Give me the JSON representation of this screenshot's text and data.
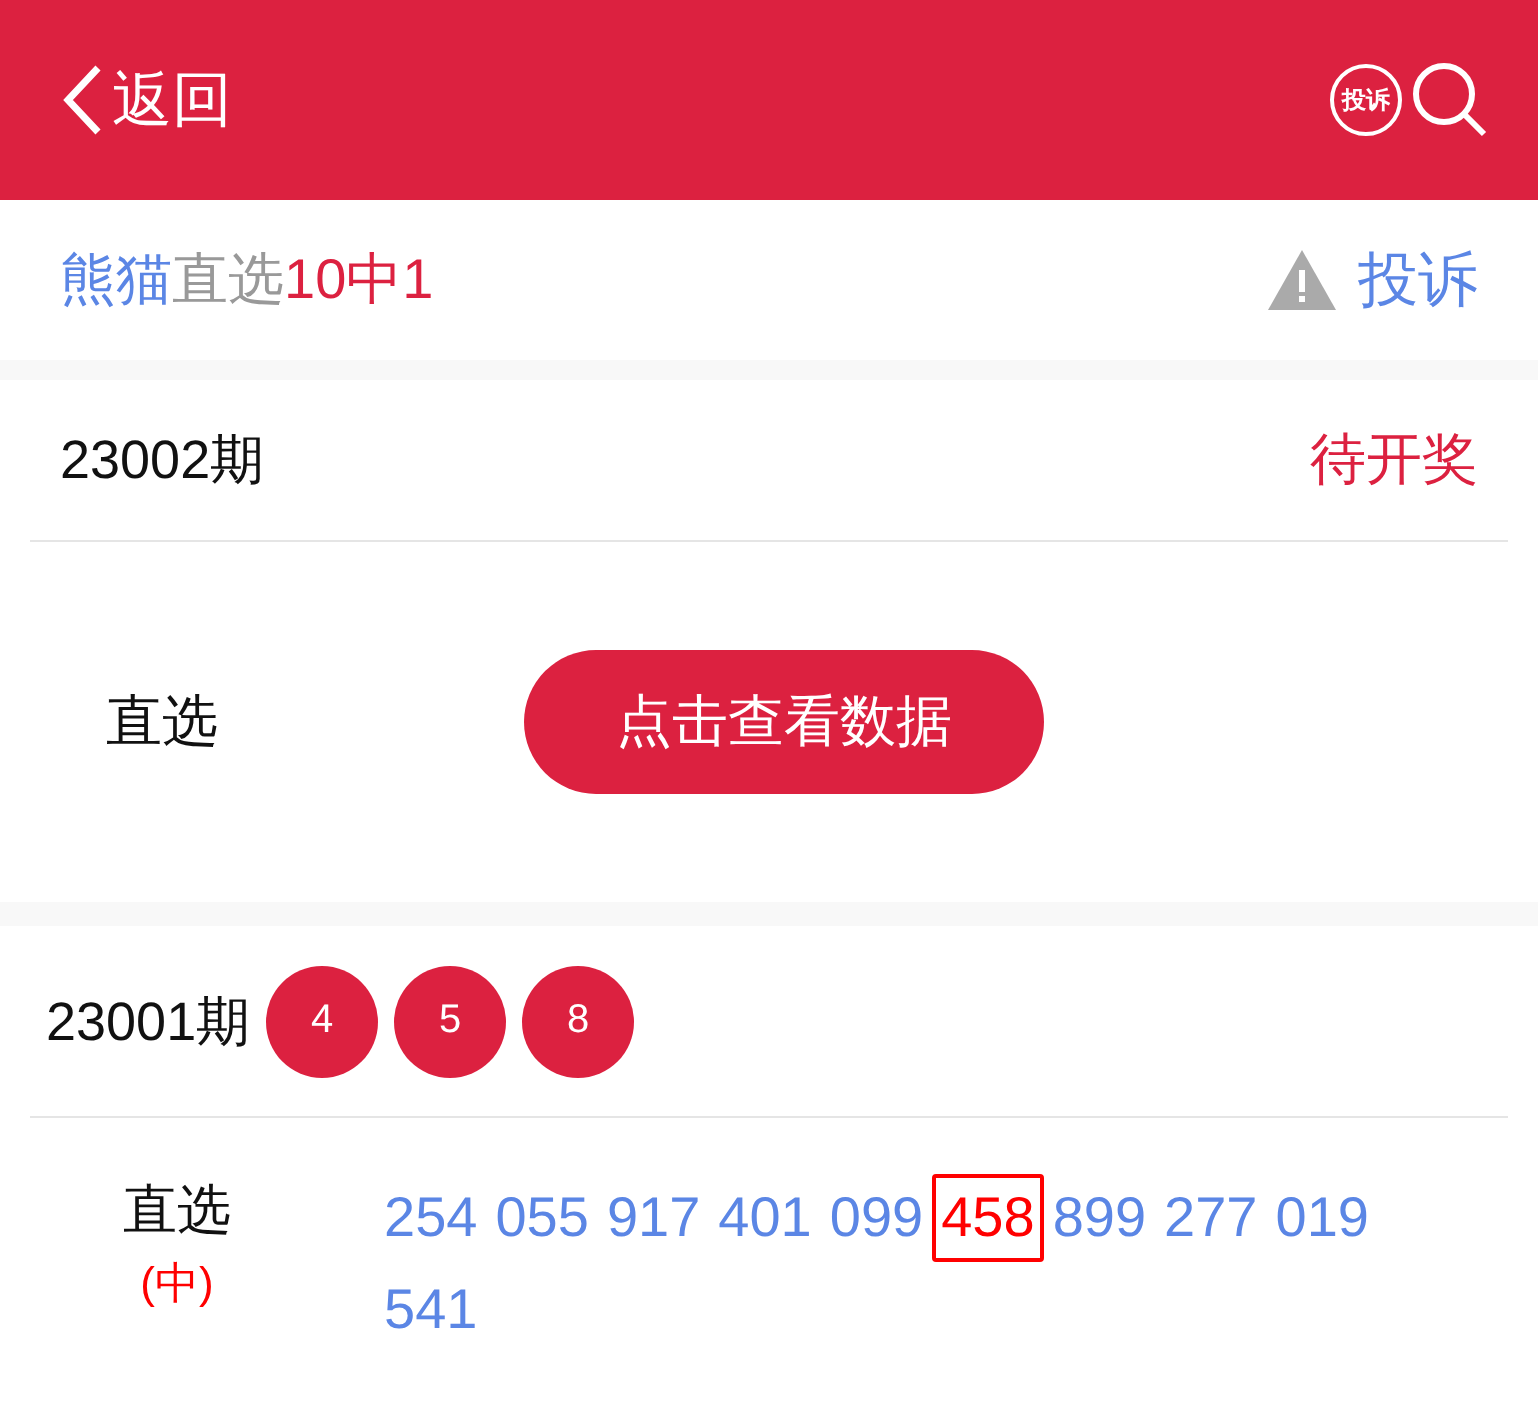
{
  "header": {
    "back_label": "返回",
    "complaint_badge": "投诉"
  },
  "title": {
    "parts": [
      {
        "text": "熊猫",
        "color": "#5b86e5"
      },
      {
        "text": "直选",
        "color": "#999999"
      },
      {
        "text": "10中1",
        "color": "#dc2140"
      }
    ],
    "complaint_link": "投诉"
  },
  "current": {
    "period": "23002期",
    "status": "待开奖",
    "play_label": "直选",
    "view_button": "点击查看数据"
  },
  "previous": {
    "period": "23001期",
    "balls": [
      "4",
      "5",
      "8"
    ],
    "play_label": "直选",
    "result": "(中)",
    "numbers": [
      {
        "text": "254",
        "hit": false
      },
      {
        "text": "055",
        "hit": false
      },
      {
        "text": "917",
        "hit": false
      },
      {
        "text": "401",
        "hit": false
      },
      {
        "text": "099",
        "hit": false
      },
      {
        "text": "458",
        "hit": true
      },
      {
        "text": "899",
        "hit": false
      },
      {
        "text": "277",
        "hit": false
      },
      {
        "text": "019",
        "hit": false
      },
      {
        "text": "541",
        "hit": false
      }
    ]
  }
}
